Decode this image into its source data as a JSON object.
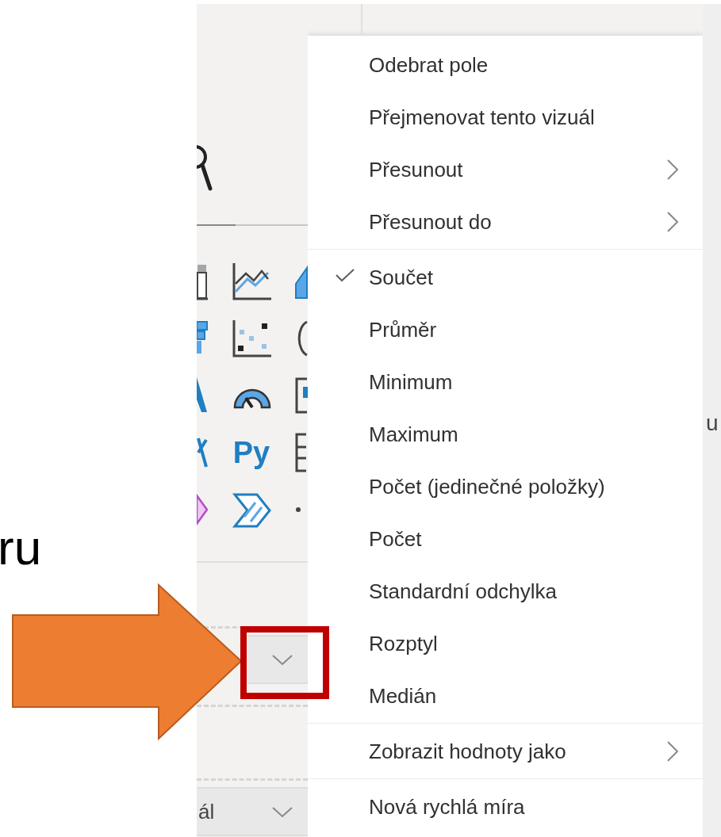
{
  "slide": {
    "caption": "ru"
  },
  "visualizations": {
    "python_label": "Py"
  },
  "field_wells": [
    {
      "kind": "empty"
    },
    {
      "kind": "text",
      "text": "ál"
    }
  ],
  "side_strip": {
    "text": "u"
  },
  "context_menu": {
    "items": [
      {
        "kind": "item",
        "label": "Odebrat pole",
        "checked": false,
        "submenu": false
      },
      {
        "kind": "item",
        "label": "Přejmenovat tento vizuál",
        "checked": false,
        "submenu": false
      },
      {
        "kind": "item",
        "label": "Přesunout",
        "checked": false,
        "submenu": true
      },
      {
        "kind": "item",
        "label": "Přesunout do",
        "checked": false,
        "submenu": true
      },
      {
        "kind": "separator"
      },
      {
        "kind": "item",
        "label": "Součet",
        "checked": true,
        "submenu": false
      },
      {
        "kind": "item",
        "label": "Průměr",
        "checked": false,
        "submenu": false
      },
      {
        "kind": "item",
        "label": "Minimum",
        "checked": false,
        "submenu": false
      },
      {
        "kind": "item",
        "label": "Maximum",
        "checked": false,
        "submenu": false
      },
      {
        "kind": "item",
        "label": "Počet (jedinečné položky)",
        "checked": false,
        "submenu": false
      },
      {
        "kind": "item",
        "label": "Počet",
        "checked": false,
        "submenu": false
      },
      {
        "kind": "item",
        "label": "Standardní odchylka",
        "checked": false,
        "submenu": false
      },
      {
        "kind": "item",
        "label": "Rozptyl",
        "checked": false,
        "submenu": false
      },
      {
        "kind": "item",
        "label": "Medián",
        "checked": false,
        "submenu": false
      },
      {
        "kind": "separator"
      },
      {
        "kind": "item",
        "label": "Zobrazit hodnoty jako",
        "checked": false,
        "submenu": true
      },
      {
        "kind": "separator"
      },
      {
        "kind": "item",
        "label": "Nová rychlá míra",
        "checked": false,
        "submenu": false
      }
    ]
  }
}
